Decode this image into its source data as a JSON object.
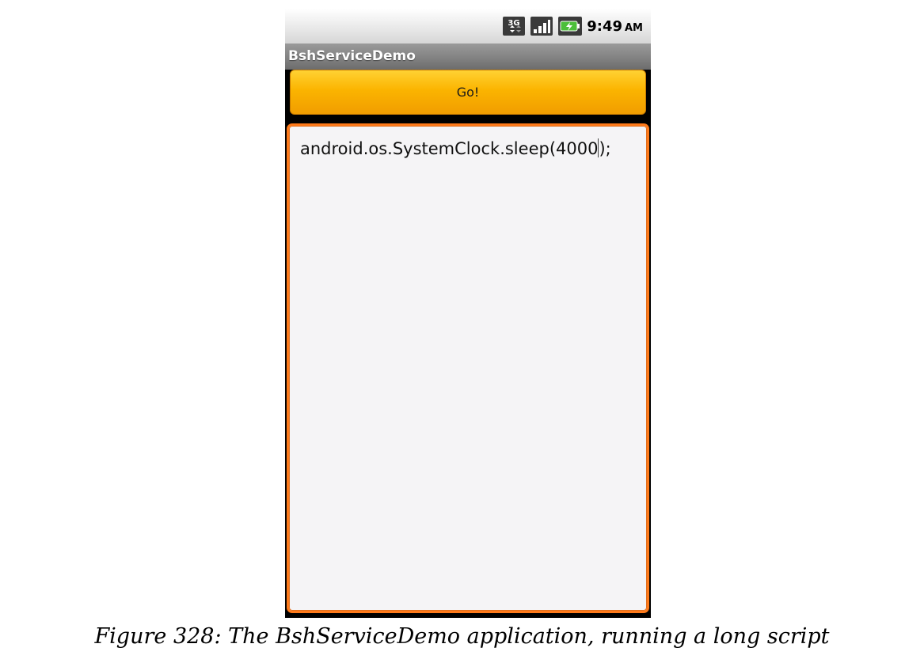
{
  "status_bar": {
    "network_icon": "3g-data-icon",
    "signal_icon": "signal-strength-icon",
    "battery_icon": "battery-charging-icon",
    "time": "9:49",
    "ampm": "AM"
  },
  "app": {
    "title": "BshServiceDemo",
    "go_button_label": "Go!",
    "script_text_before_cursor": "android.os.SystemClock.sleep(4000",
    "script_text_after_cursor": ");",
    "accent_color": "#ff7a1a",
    "button_color": "#fbb400"
  },
  "caption": {
    "text": "Figure 328: The BshServiceDemo application, running a long script"
  }
}
